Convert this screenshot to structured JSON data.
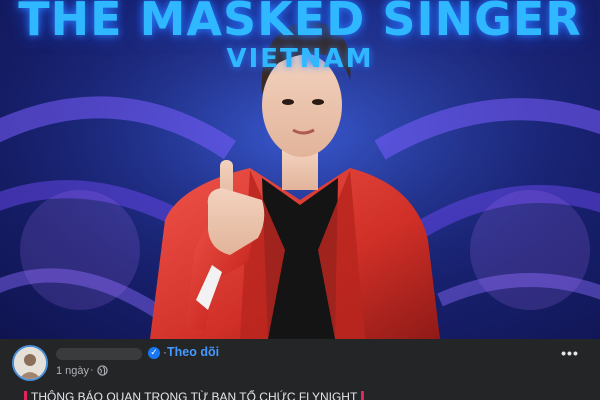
{
  "photo": {
    "show_title": "THE MASKED SINGER",
    "show_subtitle": "VIETNAM",
    "colors": {
      "stage": "#1a2478",
      "glow": "#2fb8ff",
      "jacket": "#d63a2e"
    }
  },
  "post": {
    "author_name": "",
    "verified_icon": "verified-check-icon",
    "separator": "·",
    "follow_label": "Theo dõi",
    "time_label": "1 ngày",
    "time_separator": "·",
    "privacy_icon": "globe-icon",
    "more_label": "•••",
    "text": "THÔNG BÁO QUAN TRỌNG TỪ BAN TỔ CHỨC FLYNIGHT",
    "accent": "#1877f2"
  }
}
